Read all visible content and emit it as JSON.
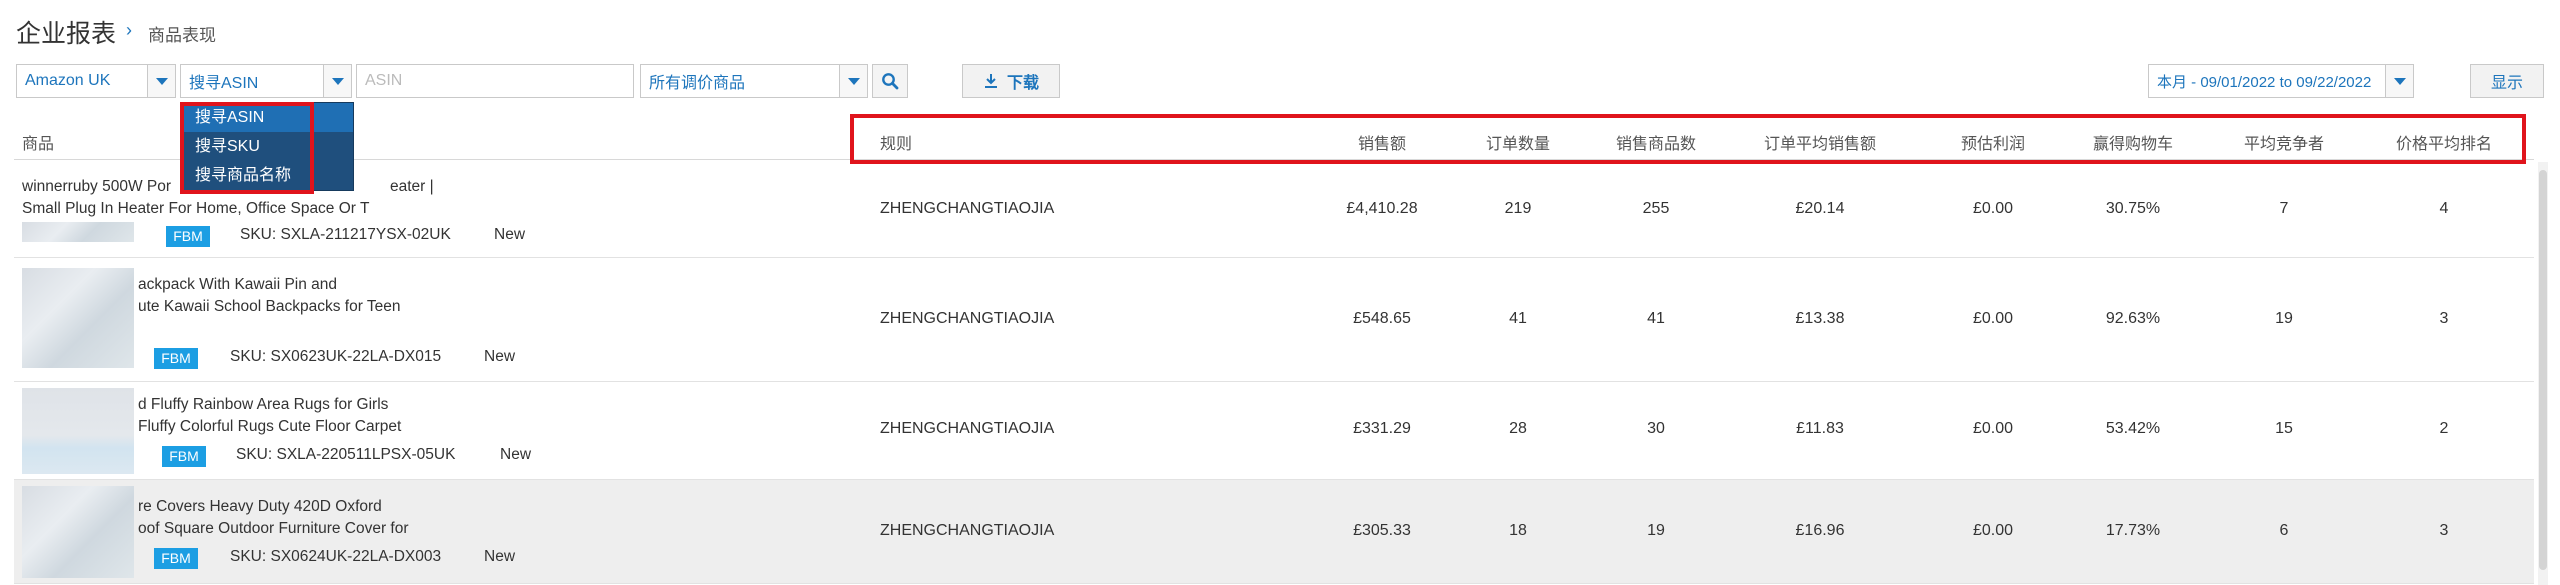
{
  "header": {
    "title": "企业报表",
    "breadcrumb_arrow": "›",
    "breadcrumb": "商品表现"
  },
  "toolbar": {
    "marketplace": "Amazon UK",
    "search_type": "搜寻ASIN",
    "search_placeholder": "ASIN",
    "product_filter": "所有调价商品",
    "download_label": "下载",
    "date_range": "本月 - 09/01/2022 to 09/22/2022",
    "show_label": "显示"
  },
  "search_dropdown": {
    "options": [
      "搜寻ASIN",
      "搜寻SKU",
      "搜寻商品名称"
    ],
    "selected_index": 0
  },
  "table": {
    "columns": [
      "商品",
      "规则",
      "销售额",
      "订单数量",
      "销售商品数",
      "订单平均销售额",
      "预估利润",
      "赢得购物车",
      "平均竞争者",
      "价格平均排名"
    ],
    "rows": [
      {
        "title_line1": "winnerruby 500W Por",
        "title_line1b": "eater |",
        "title_line2": "Small Plug In Heater For Home, Office Space Or T",
        "badge": "FBM",
        "sku": "SKU: SXLA-211217YSX-02UK",
        "condition": "New",
        "rule": "ZHENGCHANGTIAOJIA",
        "sales": "£4,410.28",
        "orders": "219",
        "units": "255",
        "avg_sale": "£20.14",
        "profit": "£0.00",
        "buybox": "30.75%",
        "competitors": "7",
        "rank": "4"
      },
      {
        "title_line1": "ackpack With Kawaii Pin and",
        "title_line2": "ute Kawaii School Backpacks for Teen",
        "badge": "FBM",
        "sku": "SKU: SX0623UK-22LA-DX015",
        "condition": "New",
        "rule": "ZHENGCHANGTIAOJIA",
        "sales": "£548.65",
        "orders": "41",
        "units": "41",
        "avg_sale": "£13.38",
        "profit": "£0.00",
        "buybox": "92.63%",
        "competitors": "19",
        "rank": "3"
      },
      {
        "title_line1": "d Fluffy Rainbow Area Rugs for Girls",
        "title_line2": "Fluffy Colorful Rugs Cute Floor Carpet",
        "badge": "FBM",
        "sku": "SKU: SXLA-220511LPSX-05UK",
        "condition": "New",
        "rule": "ZHENGCHANGTIAOJIA",
        "sales": "£331.29",
        "orders": "28",
        "units": "30",
        "avg_sale": "£11.83",
        "profit": "£0.00",
        "buybox": "53.42%",
        "competitors": "15",
        "rank": "2"
      },
      {
        "title_line1": "re Covers Heavy Duty 420D Oxford",
        "title_line2": "oof Square Outdoor Furniture Cover for",
        "badge": "FBM",
        "sku": "SKU: SX0624UK-22LA-DX003",
        "condition": "New",
        "rule": "ZHENGCHANGTIAOJIA",
        "sales": "£305.33",
        "orders": "18",
        "units": "19",
        "avg_sale": "£16.96",
        "profit": "£0.00",
        "buybox": "17.73%",
        "competitors": "6",
        "rank": "3"
      }
    ]
  },
  "colors": {
    "accent": "#1d75bc",
    "highlight": "#e0141c",
    "badge": "#1c9ee3",
    "dropdown": "#1f4f7d"
  }
}
